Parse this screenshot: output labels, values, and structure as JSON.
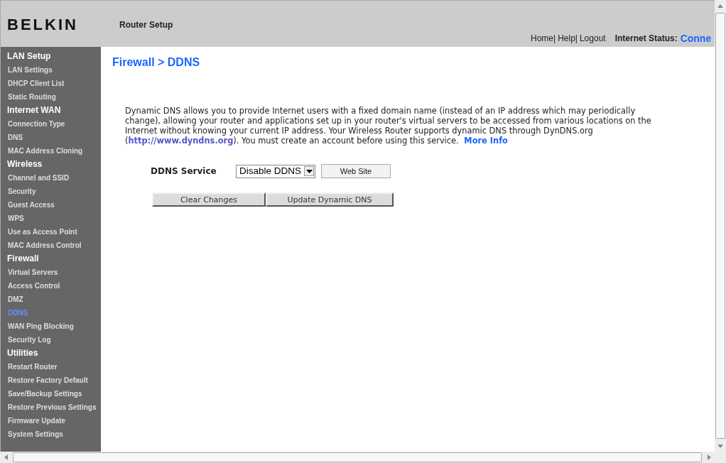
{
  "header": {
    "logo": "BELKIN",
    "title": "Router Setup",
    "nav": [
      "Home|",
      "Help|",
      "Logout"
    ],
    "status_label": "Internet Status:",
    "status_value": "Conne"
  },
  "sidebar": {
    "sections": [
      {
        "title": "LAN Setup",
        "items": [
          {
            "label": "LAN Settings",
            "selected": false
          },
          {
            "label": "DHCP Client List",
            "selected": false
          },
          {
            "label": "Static Routing",
            "selected": false
          }
        ]
      },
      {
        "title": "Internet WAN",
        "items": [
          {
            "label": "Connection Type",
            "selected": false
          },
          {
            "label": "DNS",
            "selected": false
          },
          {
            "label": "MAC Address Cloning",
            "selected": false
          }
        ]
      },
      {
        "title": "Wireless",
        "items": [
          {
            "label": "Channel and SSID",
            "selected": false
          },
          {
            "label": "Security",
            "selected": false
          },
          {
            "label": "Guest Access",
            "selected": false
          },
          {
            "label": "WPS",
            "selected": false
          },
          {
            "label": "Use as Access Point",
            "selected": false
          },
          {
            "label": "MAC Address Control",
            "selected": false
          }
        ]
      },
      {
        "title": "Firewall",
        "items": [
          {
            "label": "Virtual Servers",
            "selected": false
          },
          {
            "label": "Access Control",
            "selected": false
          },
          {
            "label": "DMZ",
            "selected": false
          },
          {
            "label": "DDNS",
            "selected": true
          },
          {
            "label": "WAN Ping Blocking",
            "selected": false
          },
          {
            "label": "Security Log",
            "selected": false
          }
        ]
      },
      {
        "title": "Utilities",
        "items": [
          {
            "label": "Restart Router",
            "selected": false
          },
          {
            "label": "Restore Factory Default",
            "selected": false
          },
          {
            "label": "Save/Backup Settings",
            "selected": false
          },
          {
            "label": "Restore Previous Settings",
            "selected": false
          },
          {
            "label": "Firmware Update",
            "selected": false
          },
          {
            "label": "System Settings",
            "selected": false
          }
        ]
      }
    ]
  },
  "page_title": "Firewall > DDNS",
  "description": [
    {
      "kind": "text",
      "text": "Dynamic DNS allows you to provide Internet users with a fixed domain name (instead of an IP address which may periodically change), allowing your router and applications set up in your router's virtual servers to be accessed from various locations on the Internet without knowing your current IP address. Your Wireless Router supports dynamic DNS through DynDNS.org ("
    },
    {
      "kind": "url",
      "text": "http://www.dyndns.org"
    },
    {
      "kind": "text",
      "text": "). You must create an account before using this service. "
    },
    {
      "kind": "more",
      "text": "More Info"
    }
  ],
  "ddns_service": {
    "label": "DDNS Service",
    "value": "Disable DDNS",
    "button": "Web Site"
  },
  "buttons": [
    "Clear Changes",
    "Update Dynamic DNS"
  ]
}
